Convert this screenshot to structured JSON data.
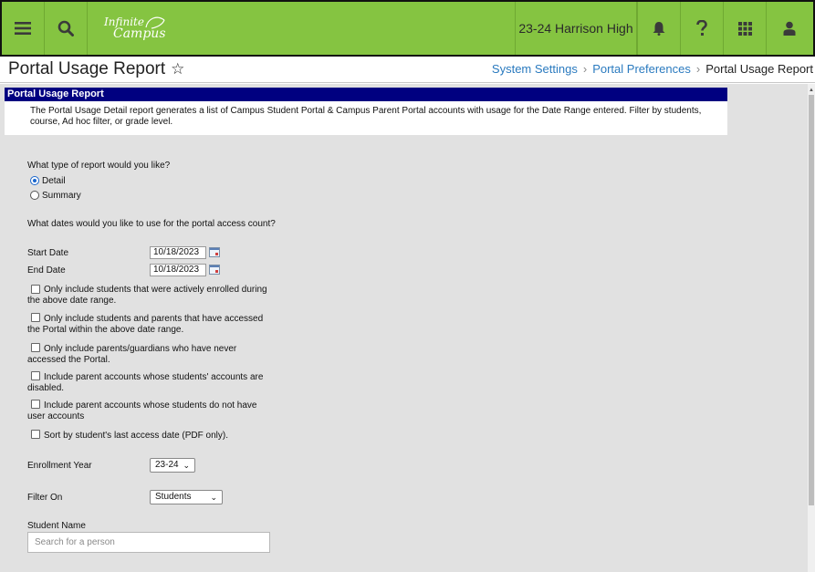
{
  "app": {
    "logo_line1": "Infinite",
    "logo_line2": "Campus",
    "school": "23-24 Harrison High"
  },
  "header": {
    "title": "Portal Usage Report",
    "breadcrumb": [
      "System Settings",
      "Portal Preferences",
      "Portal Usage Report"
    ]
  },
  "panel": {
    "title": "Portal Usage Report",
    "description": "The Portal Usage Detail report generates a list of Campus Student Portal & Campus Parent Portal accounts with usage for the Date Range entered. Filter by students, course, Ad hoc filter, or grade level."
  },
  "form": {
    "report_type_question": "What type of report would you like?",
    "report_types": [
      {
        "label": "Detail",
        "checked": true
      },
      {
        "label": "Summary",
        "checked": false
      }
    ],
    "dates_question": "What dates would you like to use for the portal access count?",
    "start_date_label": "Start Date",
    "start_date_value": "10/18/2023",
    "end_date_label": "End Date",
    "end_date_value": "10/18/2023",
    "options": [
      {
        "label": "Only include students that were actively enrolled during the above date range.",
        "checked": false
      },
      {
        "label": "Only include students and parents that have accessed the Portal within the above date range.",
        "checked": false
      },
      {
        "label": "Only include parents/guardians who have never accessed the Portal.",
        "checked": false
      },
      {
        "label": "Include parent accounts whose students' accounts are disabled.",
        "checked": false
      },
      {
        "label": "Include parent accounts whose students do not have user accounts",
        "checked": false
      },
      {
        "label": "Sort by student's last access date (PDF only).",
        "checked": false
      }
    ],
    "enrollment_year_label": "Enrollment Year",
    "enrollment_year_value": "23-24",
    "filter_on_label": "Filter On",
    "filter_on_value": "Students",
    "student_name_label": "Student Name",
    "student_name_placeholder": "Search for a person"
  },
  "colors": {
    "topbar": "#85c441",
    "panel_header": "#000080",
    "link": "#2a7abf",
    "content_bg": "#e1e1e1"
  }
}
